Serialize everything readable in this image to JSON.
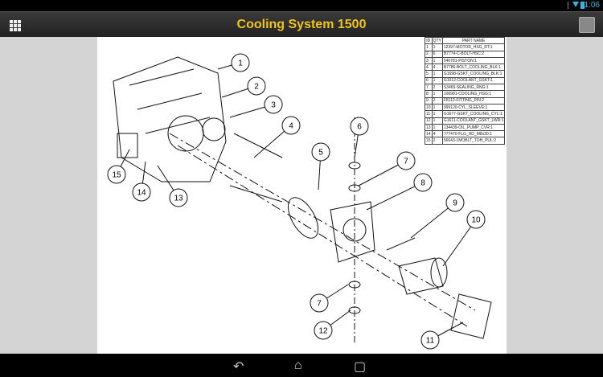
{
  "status_bar": {
    "time": "1:06",
    "icons": [
      "bluetooth-icon",
      "wifi-icon",
      "battery-icon"
    ]
  },
  "app_bar": {
    "title": "Cooling System 1500",
    "left_icon": "grid-menu-icon",
    "right_icon": "hide-view-icon"
  },
  "parts_table": {
    "headers": [
      "ID",
      "QTY",
      "PART NAME"
    ],
    "rows": [
      [
        "1",
        "1",
        "12397-MOTOR_HSG_RT:1"
      ],
      [
        "2",
        "6",
        "B7774-C-BOLT-HSC:2"
      ],
      [
        "3",
        "1",
        "546781-PISTON:1"
      ],
      [
        "4",
        "4",
        "B7786-BOLT_COOLING_BLK:1"
      ],
      [
        "5",
        "1",
        "G1698-GSKT_COOLING_BLK:1"
      ],
      [
        "6",
        "1",
        "G1012-COOLANT_GSKT:1"
      ],
      [
        "7",
        "2",
        "S3465-SEALING_RNG:1"
      ],
      [
        "8",
        "1",
        "100981-COOLING_HSG:1"
      ],
      [
        "9",
        "2",
        "F8112-FITTING_PIN:2"
      ],
      [
        "10",
        "1",
        "999120-CYL_SLEEVE:1"
      ],
      [
        "11",
        "1",
        "G1677-GSKT_COOLING_CYL:1"
      ],
      [
        "12",
        "1",
        "G1611-COOLANT_GSKT_LWR:1"
      ],
      [
        "13",
        "1",
        "134439-OIL_PUMP_CVR:1"
      ],
      [
        "14",
        "4",
        "777470-FLG_HD_M8x30:1"
      ],
      [
        "15",
        "2",
        "56643-1MOBLT_TOH_PUL:2"
      ]
    ]
  },
  "callouts": [
    "1",
    "2",
    "3",
    "4",
    "5",
    "6",
    "7",
    "8",
    "9",
    "10",
    "11",
    "12",
    "13",
    "14",
    "15",
    "7"
  ],
  "nav_bar": {
    "back_icon": "back-icon",
    "home_icon": "home-icon",
    "recents_icon": "recents-icon"
  }
}
